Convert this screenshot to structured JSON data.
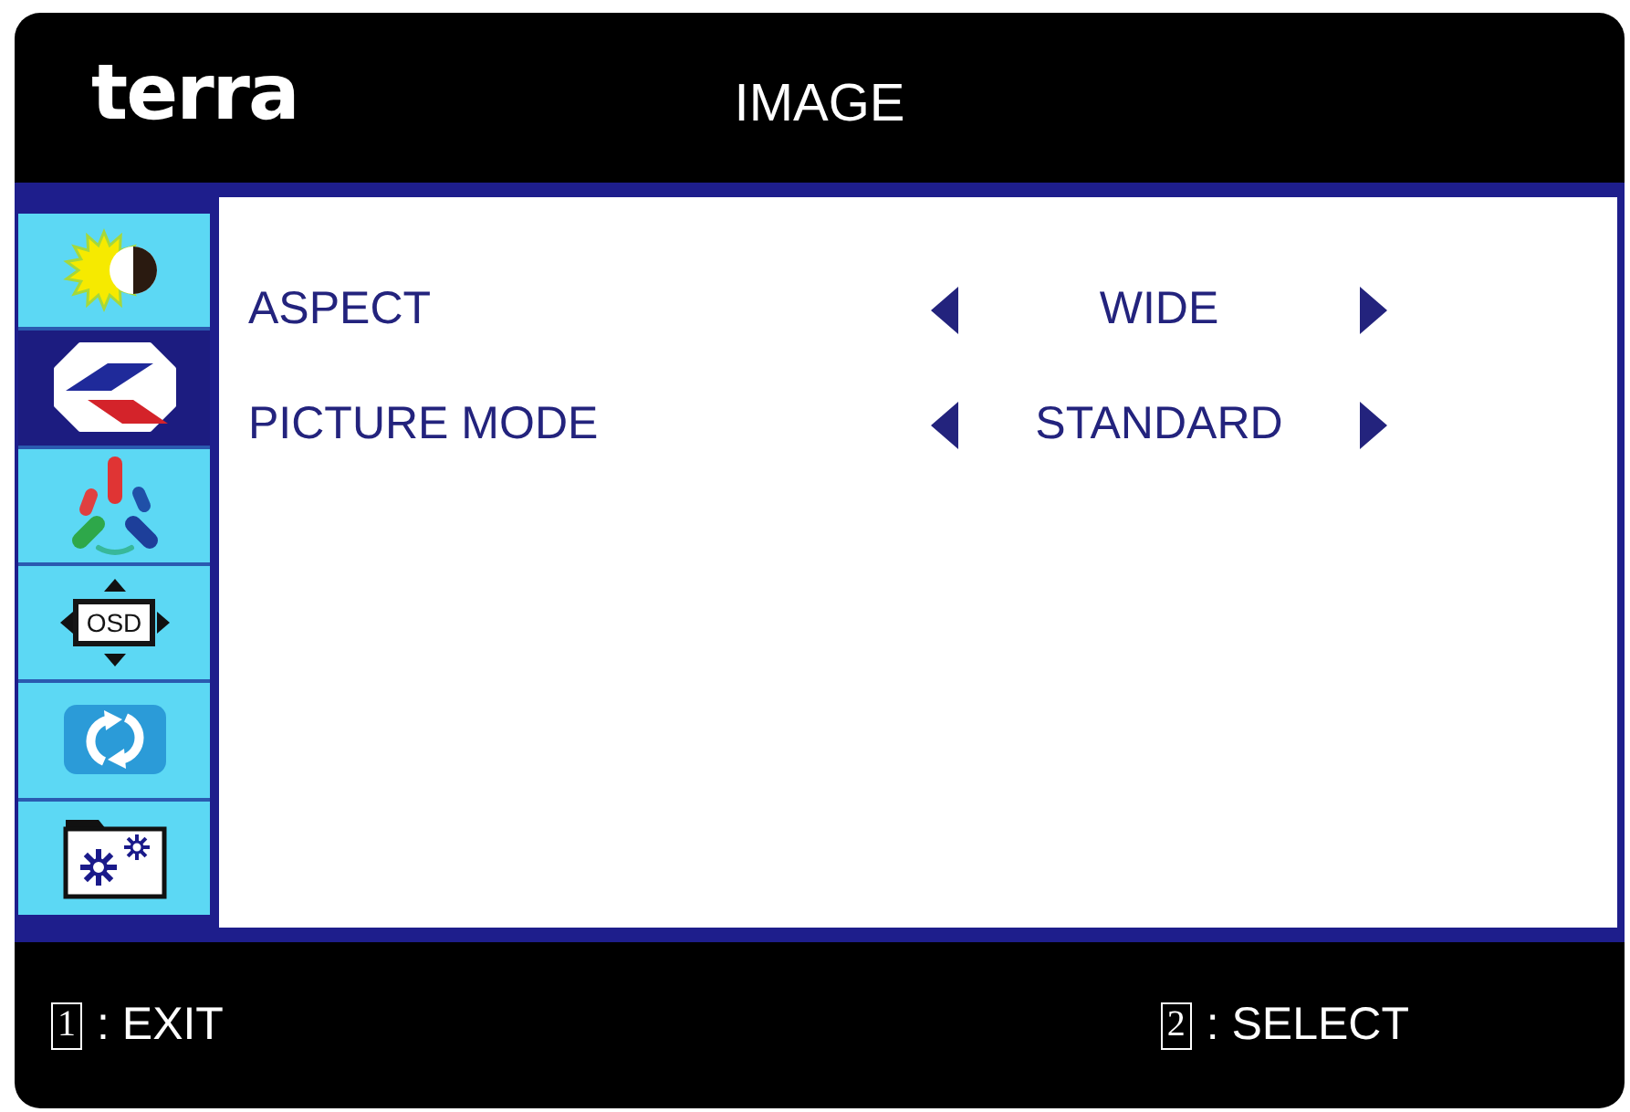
{
  "header": {
    "logo": "terra",
    "title": "IMAGE"
  },
  "sidebar": {
    "items": [
      {
        "kind": "brightness",
        "selected": false
      },
      {
        "kind": "image",
        "selected": true
      },
      {
        "kind": "color",
        "selected": false
      },
      {
        "kind": "osd",
        "label": "OSD",
        "selected": false
      },
      {
        "kind": "reset",
        "selected": false
      },
      {
        "kind": "setup",
        "selected": false
      }
    ]
  },
  "settings": [
    {
      "label": "ASPECT",
      "value": "WIDE"
    },
    {
      "label": "PICTURE MODE",
      "value": "STANDARD"
    }
  ],
  "footer": {
    "hints": [
      {
        "key": "1",
        "action": ": EXIT"
      },
      {
        "key": "2",
        "action": ": SELECT"
      }
    ]
  }
}
